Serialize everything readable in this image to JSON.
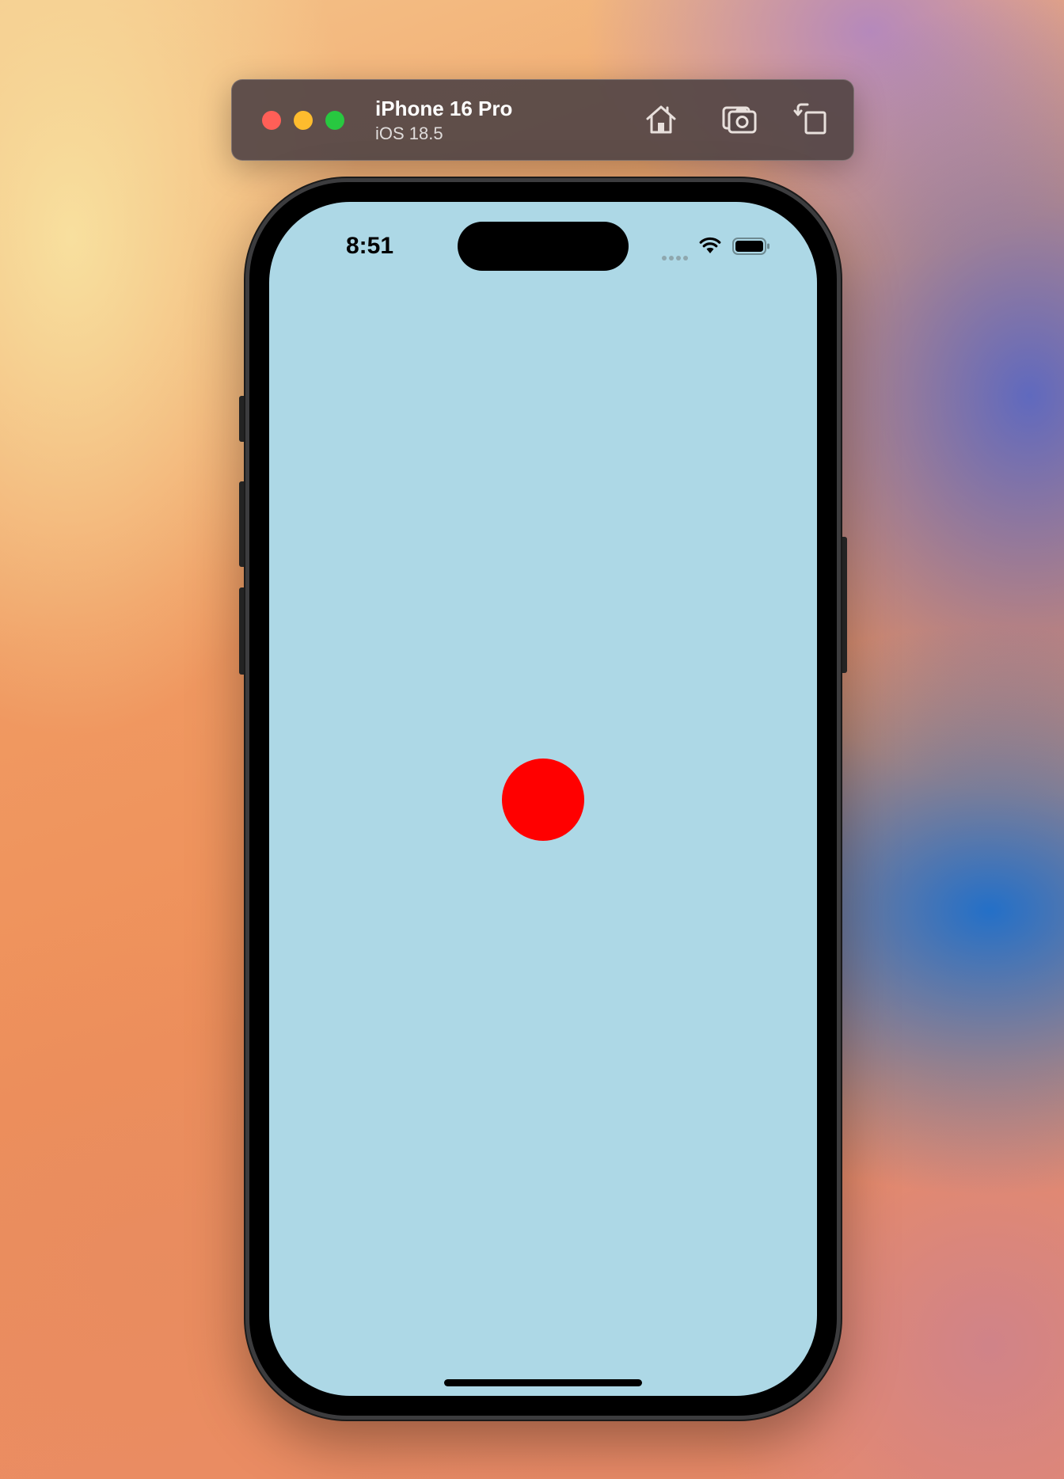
{
  "simulator": {
    "device_name": "iPhone 16 Pro",
    "os_version": "iOS 18.5",
    "window_controls": {
      "close_color": "#ff5f57",
      "minimize_color": "#febc2e",
      "zoom_color": "#28c840"
    },
    "toolbar_icons": [
      "home-icon",
      "screenshot-icon",
      "rotate-icon"
    ]
  },
  "status_bar": {
    "time": "8:51",
    "icons": [
      "signal-dots-icon",
      "wifi-icon",
      "battery-icon"
    ]
  },
  "app": {
    "background_color": "#add8e6",
    "dot_color": "#ff0000"
  }
}
